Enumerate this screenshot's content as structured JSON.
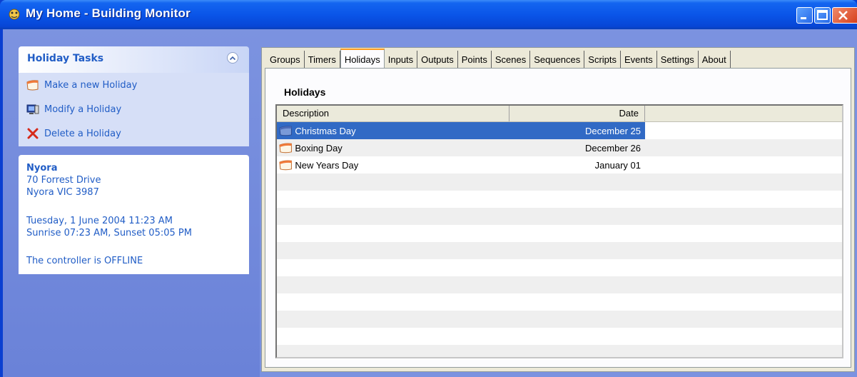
{
  "window": {
    "title": "My Home - Building Monitor"
  },
  "task_pane": {
    "title": "Holiday Tasks",
    "items": [
      {
        "label": "Make a new Holiday",
        "icon": "calendar-icon"
      },
      {
        "label": "Modify a Holiday",
        "icon": "monitor-edit-icon"
      },
      {
        "label": "Delete a Holiday",
        "icon": "red-x-icon"
      }
    ]
  },
  "info": {
    "name": "Nyora",
    "address1": "70 Forrest Drive",
    "address2": "Nyora VIC 3987",
    "datetime": "Tuesday, 1 June 2004 11:23 AM",
    "sun": "Sunrise 07:23 AM, Sunset 05:05 PM",
    "status": "The controller is OFFLINE"
  },
  "tabs": [
    "Groups",
    "Timers",
    "Holidays",
    "Inputs",
    "Outputs",
    "Points",
    "Scenes",
    "Sequences",
    "Scripts",
    "Events",
    "Settings",
    "About"
  ],
  "active_tab": "Holidays",
  "holidays": {
    "title": "Holidays",
    "columns": {
      "description": "Description",
      "date": "Date"
    },
    "rows": [
      {
        "description": "Christmas Day",
        "date": "December 25",
        "selected": true
      },
      {
        "description": "Boxing Day",
        "date": "December 26",
        "selected": false
      },
      {
        "description": "New Years Day",
        "date": "January 01",
        "selected": false
      }
    ]
  },
  "colors": {
    "titlebar": "#0a55e8",
    "task_link": "#215dc6",
    "selection": "#316ac5",
    "tab_highlight": "#ff9d1e"
  }
}
